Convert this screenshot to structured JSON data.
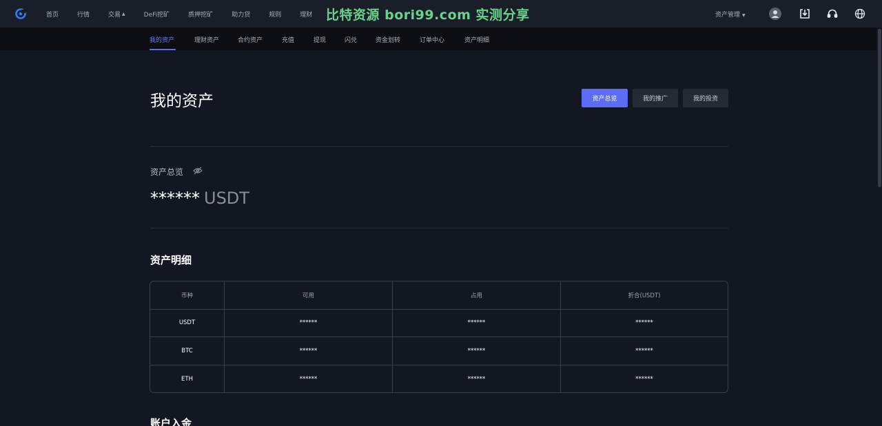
{
  "topnav": {
    "items": [
      {
        "label": "首页"
      },
      {
        "label": "行情"
      },
      {
        "label": "交易",
        "has_dropdown": true
      },
      {
        "label": "DeFi挖矿"
      },
      {
        "label": "质押挖矿"
      },
      {
        "label": "助力贷"
      },
      {
        "label": "规则"
      },
      {
        "label": "理财"
      }
    ],
    "watermark": "比特资源 bori99.com 实测分享",
    "asset_management": "资产管理",
    "icons": [
      "user-avatar-icon",
      "download-icon",
      "headset-icon",
      "globe-icon"
    ]
  },
  "subnav": {
    "items": [
      {
        "label": "我的资产",
        "active": true
      },
      {
        "label": "理财资产"
      },
      {
        "label": "合约资产"
      },
      {
        "label": "充值"
      },
      {
        "label": "提现"
      },
      {
        "label": "闪兑"
      },
      {
        "label": "资金划转"
      },
      {
        "label": "订单中心"
      },
      {
        "label": "资产明细"
      }
    ]
  },
  "main": {
    "title": "我的资产",
    "tabs": [
      {
        "label": "资产总览",
        "active": true
      },
      {
        "label": "我的推广"
      },
      {
        "label": "我的投资"
      }
    ],
    "overview_label": "资产总览",
    "balance_value": "******",
    "balance_unit": "USDT",
    "details_title": "资产明细",
    "table": {
      "headers": [
        "币种",
        "可用",
        "占用",
        "折合(USDT)"
      ],
      "rows": [
        [
          "USDT",
          "******",
          "******",
          "******"
        ],
        [
          "BTC",
          "******",
          "******",
          "******"
        ],
        [
          "ETH",
          "******",
          "******",
          "******"
        ]
      ]
    },
    "next_section_title": "账户入金"
  },
  "colors": {
    "background": "#131722",
    "accent": "#5d6cf4",
    "watermark": "#6ad38a"
  }
}
